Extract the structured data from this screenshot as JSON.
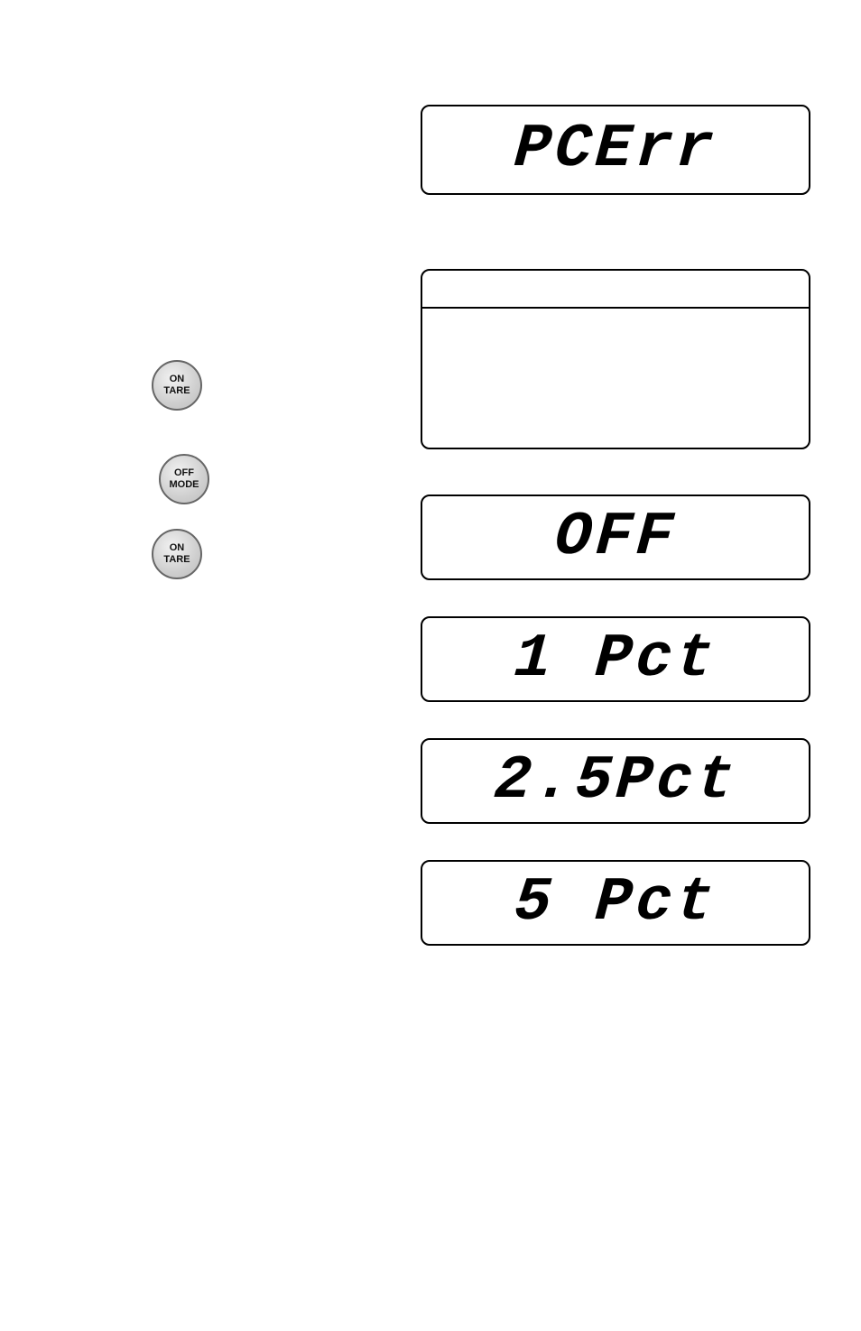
{
  "displays": {
    "pcerr": "PCErr",
    "off": "OFF",
    "one_pct": "1 Pct",
    "twofive_pct": "2.5Pct",
    "five_pct": "5 Pct"
  },
  "buttons": {
    "on_tare": {
      "line1": "ON",
      "line2": "TARE"
    },
    "off_mode": {
      "line1": "OFF",
      "line2": "MODE"
    }
  }
}
